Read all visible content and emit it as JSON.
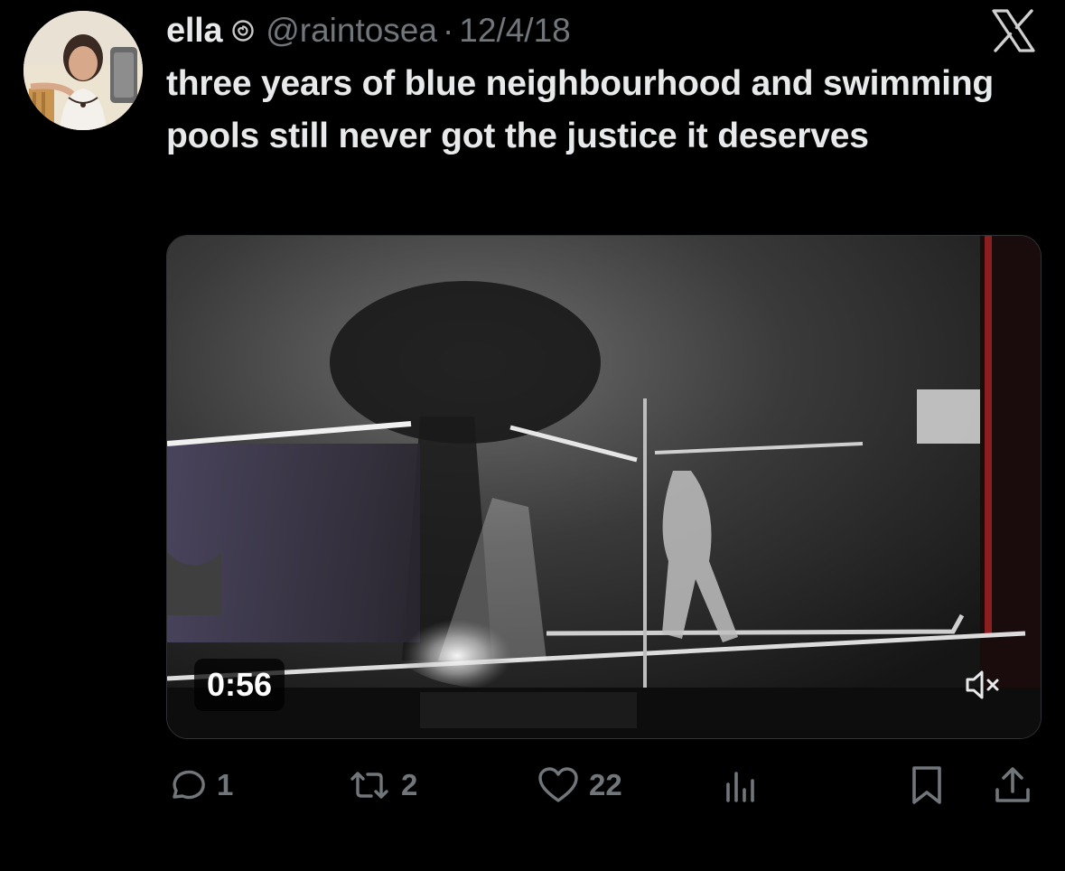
{
  "tweet": {
    "author_name": "ella",
    "verified_icon": "spiral-badge-icon",
    "handle": "@raintosea",
    "separator": "·",
    "date": "12/4/18",
    "text": "three years of blue neighbourhood and swimming pools still never got the justice it deserves"
  },
  "media": {
    "duration": "0:56",
    "mute_icon": "speaker-muted-icon"
  },
  "actions": {
    "replies": "1",
    "reposts": "2",
    "likes": "22",
    "views_icon": "bar-chart-icon",
    "bookmark_icon": "bookmark-icon",
    "share_icon": "share-icon"
  },
  "colors": {
    "background": "#000000",
    "primary_text": "#e7e9ea",
    "secondary_text": "#71767b",
    "border": "#2f3336"
  }
}
